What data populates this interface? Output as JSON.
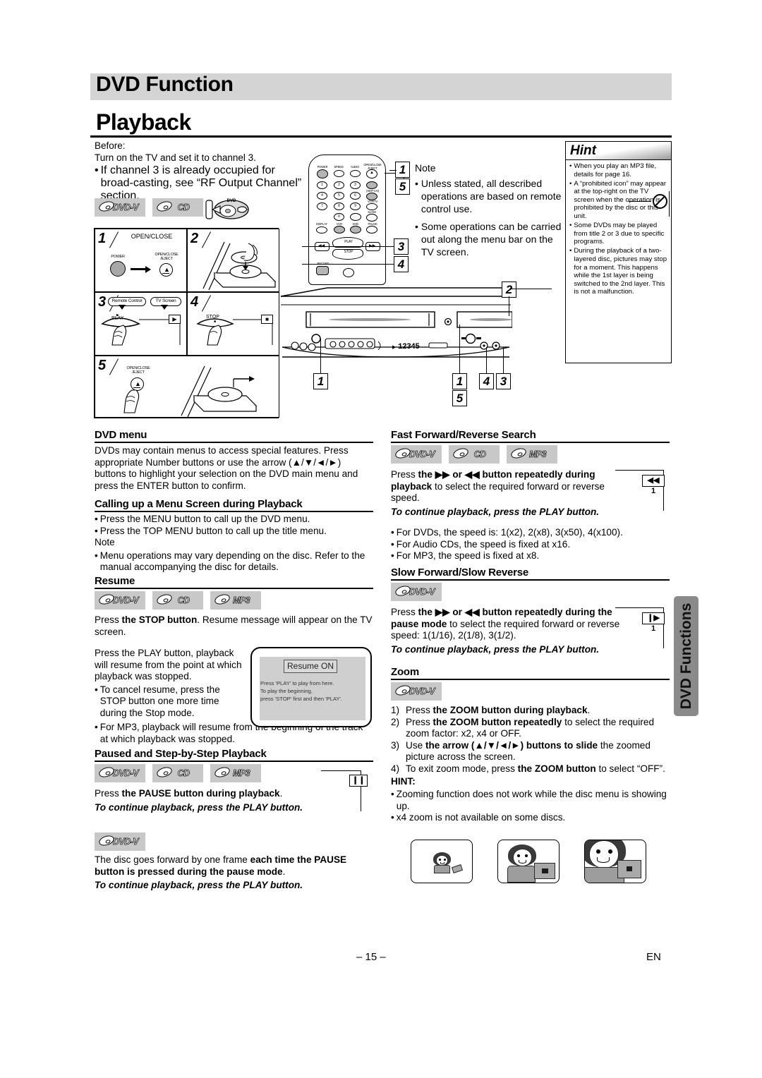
{
  "header": {
    "chapter": "DVD Function",
    "section": "Playback"
  },
  "before": {
    "label": "Before:",
    "line": "Turn on the TV and set it to channel 3.",
    "bullet_dot": "•",
    "bullet": "If channel 3 is already occupied for broad-casting, see “RF Output Channel” section."
  },
  "badges": {
    "dvdv": "DVD-V",
    "cd": "CD",
    "mp3": "MP3"
  },
  "steps": [
    {
      "num": "1",
      "caption": "OPEN/CLOSE",
      "left_label": "POWER",
      "right_label": "OPEN/CLOSE\n/EJECT"
    },
    {
      "num": "2",
      "caption": ""
    },
    {
      "num": "3",
      "bubble_a": "Remote Control",
      "bubble_b": "TV Screen",
      "key": "PLAY"
    },
    {
      "num": "4",
      "key": "STOP"
    },
    {
      "num": "5",
      "key": "OPEN/CLOSE\n/EJECT"
    }
  ],
  "remote": {
    "power": "POWER",
    "speed": "SPEED",
    "audio": "AUDIO",
    "open_close": "OPEN/CLOSE\n/EJECT",
    "keys": [
      "1",
      "2",
      "3",
      "4",
      "5",
      "6",
      "7",
      "8",
      "9",
      "0"
    ],
    "display": "DISPLAY",
    "vcr": "VCR",
    "dvd": "DVD",
    "pause": "PAUSE",
    "slow": "SLOW",
    "skip_ch": "(SKIP-CH)",
    "vcr_tv": "VCR/TV",
    "play": "PLAY",
    "stop": "STOP",
    "record": "RECORD"
  },
  "panel": {
    "display_digits": "12345"
  },
  "callouts": {
    "note_box_top": "1",
    "note_box_bottom": "5",
    "panel_left": "1",
    "panel_center_top": "1",
    "panel_center_bottom": "5",
    "panel_four": "4",
    "panel_three": "3",
    "panel_two": "2",
    "step_three": "3",
    "step_four": "4"
  },
  "note": {
    "title": "Note",
    "bullets": [
      "Unless stated, all described operations are based on remote control use.",
      "Some operations can be carried out along the menu bar on the TV screen."
    ]
  },
  "hint": {
    "title": "Hint",
    "bullets": [
      "When you play an MP3 file, details for page 16.",
      "A “prohibited icon” may appear at the top-right on the TV screen when the operation is prohibited by the disc or this unit.",
      "Some DVDs may be played from title 2 or 3 due to specific programs.",
      "During the playback of a two-layered disc, pictures may stop for a moment. This happens while the 1st layer is being switched to the 2nd layer. This is not a malfunction."
    ]
  },
  "dvd_menu": {
    "heading": "DVD menu",
    "body_1": "DVDs may contain menus to access special features. Press appropriate Number buttons or use the arrow (",
    "arrows": "▲/▼/◄/►",
    "body_2": ") buttons to highlight your selection on the DVD main menu and press the ENTER button to confirm."
  },
  "calling_menu": {
    "heading": "Calling up a Menu Screen during Playback",
    "bullets": [
      "Press the MENU button to call up the DVD menu.",
      "Press the TOP MENU button to call up the title menu."
    ],
    "note_label": "Note",
    "note_bullet": "Menu operations may vary depending on the disc. Refer to the manual accompanying the disc for details."
  },
  "resume": {
    "heading": "Resume",
    "p1_pre": "Press ",
    "p1_bold": "the STOP button",
    "p1_post": ". Resume message will appear on the TV screen.",
    "p2": "Press the PLAY button, playback will resume from the point at which playback was stopped.",
    "bullets": [
      "To cancel resume, press the STOP button one more time during the Stop mode.",
      "For MP3, playback will resume from the beginning  of the track at which playback was stopped."
    ],
    "screen": {
      "title": "Resume ON",
      "lines": [
        "Press 'PLAY' to play from here.",
        "To play the beginning,",
        "press 'STOP' first and then 'PLAY'."
      ]
    }
  },
  "paused": {
    "heading": "Paused and Step-by-Step Playback",
    "p1_pre": "Press ",
    "p1_bold": "the PAUSE button during playback",
    "p1_post": ".",
    "p1_italic": "To continue playback, press the PLAY button.",
    "p2_pre": "The disc goes forward by one frame ",
    "p2_bold": "each time the PAUSE button is pressed during the pause mode",
    "p2_post": ".",
    "p2_italic": "To continue playback, press the PLAY button.",
    "chip": "❙❙"
  },
  "ffwd": {
    "heading": "Fast Forward/Reverse Search",
    "p_pre": "Press ",
    "p_bold_a": "the ▶▶ or ◀◀ button repeatedly during playback",
    "p_post": " to select the required forward or reverse speed.",
    "p_italic": "To continue playback, press the PLAY button.",
    "bullets": [
      "For DVDs, the speed is: 1(x2), 2(x8), 3(x50), 4(x100).",
      "For Audio CDs, the speed is fixed at x16.",
      "For MP3, the speed is fixed at x8."
    ],
    "chip": "◀◀ 1"
  },
  "slow": {
    "heading": "Slow Forward/Slow Reverse",
    "p_pre": "Press ",
    "p_bold_a": "the ▶▶ or ◀◀ button repeatedly during the pause mode",
    "p_post": " to select the required forward or reverse speed: 1(1/16), 2(1/8), 3(1/2).",
    "p_italic": "To continue playback, press the PLAY button.",
    "chip": "❙▶ 1"
  },
  "zoom": {
    "heading": "Zoom",
    "steps": [
      {
        "mk": "1)",
        "pre": "Press ",
        "bold": "the ZOOM button during playback",
        "post": "."
      },
      {
        "mk": "2)",
        "pre": "Press ",
        "bold": "the ZOOM button repeatedly",
        "post": " to select the required zoom factor: x2, x4 or OFF."
      },
      {
        "mk": "3)",
        "pre": "Use ",
        "bold": "the arrow (▲/▼/◄/►) buttons to slide",
        "post": " the zoomed picture across the screen."
      },
      {
        "mk": "4)",
        "pre": "To exit zoom mode, press ",
        "bold": "the ZOOM button",
        "post": " to select “OFF”."
      }
    ],
    "hint_label": "HINT:",
    "hint_bullets": [
      "Zooming function does not work while the disc menu is showing up.",
      "x4 zoom is not available on some discs."
    ]
  },
  "sidetab": {
    "label": "DVD Functions"
  },
  "footer": {
    "page": "– 15 –",
    "lang": "EN"
  },
  "bullet_char": "•"
}
